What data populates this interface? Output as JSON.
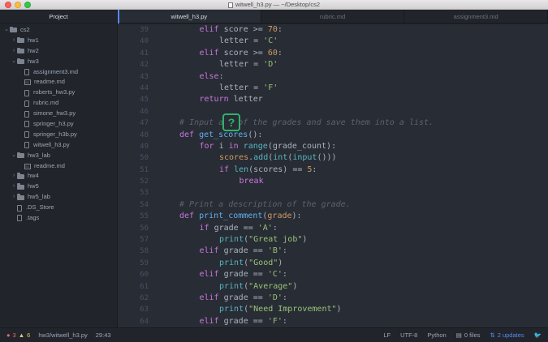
{
  "window": {
    "title": "witwell_h3.py — ~/Desktop/cs2"
  },
  "sidebar": {
    "header": "Project",
    "items": [
      {
        "label": "cs2",
        "type": "folder",
        "open": true,
        "depth": 0
      },
      {
        "label": "hw1",
        "type": "folder",
        "open": false,
        "depth": 1
      },
      {
        "label": "hw2",
        "type": "folder",
        "open": false,
        "depth": 1
      },
      {
        "label": "hw3",
        "type": "folder",
        "open": true,
        "depth": 1
      },
      {
        "label": "assignment3.md",
        "type": "file",
        "depth": 2
      },
      {
        "label": "readme.md",
        "type": "md",
        "depth": 2
      },
      {
        "label": "roberts_hw3.py",
        "type": "file",
        "depth": 2
      },
      {
        "label": "rubric.md",
        "type": "file",
        "depth": 2
      },
      {
        "label": "simone_hw3.py",
        "type": "file",
        "depth": 2
      },
      {
        "label": "springer_h3.py",
        "type": "file",
        "depth": 2
      },
      {
        "label": "springer_h3b.py",
        "type": "file",
        "depth": 2
      },
      {
        "label": "witwell_h3.py",
        "type": "file",
        "depth": 2
      },
      {
        "label": "hw3_lab",
        "type": "folder",
        "open": true,
        "depth": 1
      },
      {
        "label": "readme.md",
        "type": "md",
        "depth": 2
      },
      {
        "label": "hw4",
        "type": "folder",
        "open": false,
        "depth": 1
      },
      {
        "label": "hw5",
        "type": "folder",
        "open": false,
        "depth": 1
      },
      {
        "label": "hw5_lab",
        "type": "folder",
        "open": false,
        "depth": 1
      },
      {
        "label": ".DS_Store",
        "type": "file",
        "depth": 1
      },
      {
        "label": ".tags",
        "type": "file",
        "depth": 1
      }
    ]
  },
  "tabs": [
    {
      "label": "witwell_h3.py",
      "active": true
    },
    {
      "label": "rubric.md",
      "active": false
    },
    {
      "label": "assignment3.md",
      "active": false
    }
  ],
  "editor": {
    "lines": [
      {
        "n": "39",
        "indent": 2,
        "tokens": [
          [
            "kw",
            "elif"
          ],
          [
            "op",
            " score >= "
          ],
          [
            "num",
            "70"
          ],
          [
            "op",
            ":"
          ]
        ]
      },
      {
        "n": "40",
        "indent": 3,
        "tokens": [
          [
            "op",
            "letter = "
          ],
          [
            "str",
            "'C'"
          ]
        ]
      },
      {
        "n": "41",
        "indent": 2,
        "tokens": [
          [
            "kw",
            "elif"
          ],
          [
            "op",
            " score >= "
          ],
          [
            "num",
            "60"
          ],
          [
            "op",
            ":"
          ]
        ]
      },
      {
        "n": "42",
        "indent": 3,
        "tokens": [
          [
            "op",
            "letter = "
          ],
          [
            "str",
            "'D'"
          ]
        ]
      },
      {
        "n": "43",
        "indent": 2,
        "tokens": [
          [
            "kw",
            "else"
          ],
          [
            "op",
            ":"
          ]
        ]
      },
      {
        "n": "44",
        "indent": 3,
        "tokens": [
          [
            "op",
            "letter = "
          ],
          [
            "str",
            "'F'"
          ]
        ]
      },
      {
        "n": "45",
        "indent": 2,
        "tokens": [
          [
            "kw",
            "return"
          ],
          [
            "op",
            " letter"
          ]
        ]
      },
      {
        "n": "46",
        "indent": 0,
        "tokens": []
      },
      {
        "n": "47",
        "indent": 1,
        "tokens": [
          [
            "cm",
            "# Input all of the grades and save them into a list."
          ]
        ]
      },
      {
        "n": "48",
        "indent": 1,
        "tokens": [
          [
            "kw",
            "def "
          ],
          [
            "fn",
            "get_scores"
          ],
          [
            "op",
            "():"
          ]
        ]
      },
      {
        "n": "49",
        "indent": 2,
        "tokens": [
          [
            "kw",
            "for"
          ],
          [
            "op",
            " i "
          ],
          [
            "kw",
            "in"
          ],
          [
            "op",
            " "
          ],
          [
            "bi",
            "range"
          ],
          [
            "op",
            "(grade_count):"
          ]
        ]
      },
      {
        "n": "50",
        "indent": 3,
        "tokens": [
          [
            "num",
            "scores"
          ],
          [
            "op",
            "."
          ],
          [
            "bi",
            "add"
          ],
          [
            "op",
            "("
          ],
          [
            "bi",
            "int"
          ],
          [
            "op",
            "("
          ],
          [
            "bi",
            "input"
          ],
          [
            "op",
            "()))"
          ]
        ]
      },
      {
        "n": "51",
        "indent": 3,
        "tokens": [
          [
            "kw",
            "if"
          ],
          [
            "op",
            " "
          ],
          [
            "bi",
            "len"
          ],
          [
            "op",
            "(scores) == "
          ],
          [
            "num",
            "5"
          ],
          [
            "op",
            ":"
          ]
        ]
      },
      {
        "n": "52",
        "indent": 4,
        "tokens": [
          [
            "kw",
            "break"
          ]
        ]
      },
      {
        "n": "53",
        "indent": 0,
        "tokens": []
      },
      {
        "n": "54",
        "indent": 1,
        "tokens": [
          [
            "cm",
            "# Print a description of the grade."
          ]
        ]
      },
      {
        "n": "55",
        "indent": 1,
        "tokens": [
          [
            "kw",
            "def "
          ],
          [
            "fn",
            "print_comment"
          ],
          [
            "op",
            "("
          ],
          [
            "num",
            "grade"
          ],
          [
            "op",
            "):"
          ]
        ]
      },
      {
        "n": "56",
        "indent": 2,
        "tokens": [
          [
            "kw",
            "if"
          ],
          [
            "op",
            " grade == "
          ],
          [
            "str",
            "'A'"
          ],
          [
            "op",
            ":"
          ]
        ]
      },
      {
        "n": "57",
        "indent": 3,
        "tokens": [
          [
            "bi",
            "print"
          ],
          [
            "op",
            "("
          ],
          [
            "str",
            "\"Great job\""
          ],
          [
            "op",
            ")"
          ]
        ]
      },
      {
        "n": "58",
        "indent": 2,
        "tokens": [
          [
            "kw",
            "elif"
          ],
          [
            "op",
            " grade == "
          ],
          [
            "str",
            "'B'"
          ],
          [
            "op",
            ":"
          ]
        ]
      },
      {
        "n": "59",
        "indent": 3,
        "tokens": [
          [
            "bi",
            "print"
          ],
          [
            "op",
            "("
          ],
          [
            "str",
            "\"Good\""
          ],
          [
            "op",
            ")"
          ]
        ]
      },
      {
        "n": "60",
        "indent": 2,
        "tokens": [
          [
            "kw",
            "elif"
          ],
          [
            "op",
            " grade == "
          ],
          [
            "str",
            "'C'"
          ],
          [
            "op",
            ":"
          ]
        ]
      },
      {
        "n": "61",
        "indent": 3,
        "tokens": [
          [
            "bi",
            "print"
          ],
          [
            "op",
            "("
          ],
          [
            "str",
            "\"Average\""
          ],
          [
            "op",
            ")"
          ]
        ]
      },
      {
        "n": "62",
        "indent": 2,
        "tokens": [
          [
            "kw",
            "elif"
          ],
          [
            "op",
            " grade == "
          ],
          [
            "str",
            "'D'"
          ],
          [
            "op",
            ":"
          ]
        ]
      },
      {
        "n": "63",
        "indent": 3,
        "tokens": [
          [
            "bi",
            "print"
          ],
          [
            "op",
            "("
          ],
          [
            "str",
            "\"Need Improvement\""
          ],
          [
            "op",
            ")"
          ]
        ]
      },
      {
        "n": "64",
        "indent": 2,
        "tokens": [
          [
            "kw",
            "elif"
          ],
          [
            "op",
            " grade == "
          ],
          [
            "str",
            "'F'"
          ],
          [
            "op",
            ":"
          ]
        ]
      }
    ],
    "help_badge": "?"
  },
  "statusbar": {
    "errors": "3",
    "warnings": "6",
    "path": "hw3/witwell_h3.py",
    "cursor": "29:43",
    "line_ending": "LF",
    "encoding": "UTF-8",
    "grammar": "Python",
    "files": "0 files",
    "updates": "2 updates"
  }
}
